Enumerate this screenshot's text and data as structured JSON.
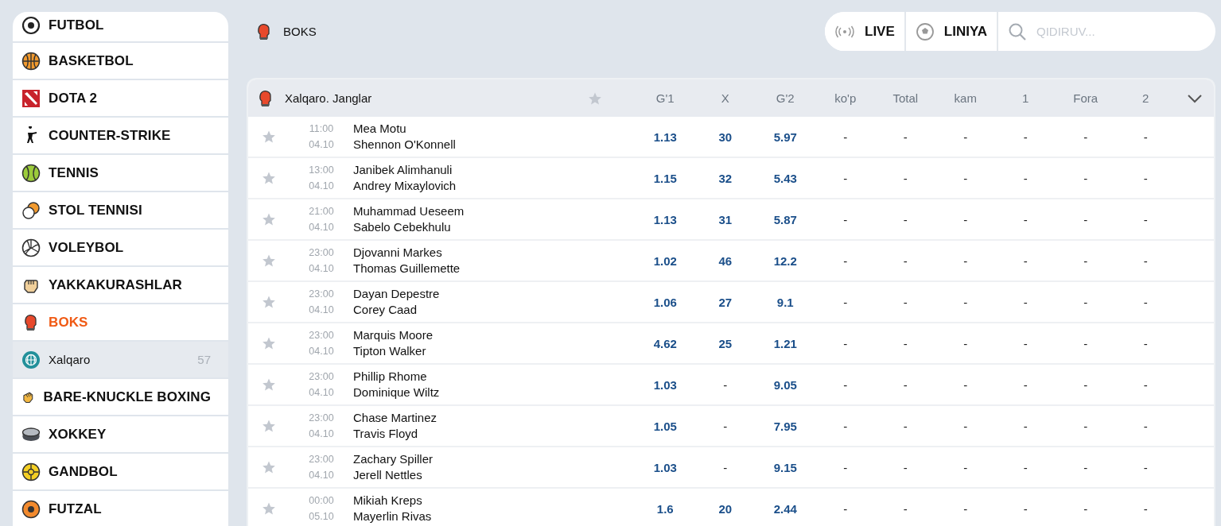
{
  "sidebar": {
    "items": [
      {
        "label": "FUTBOL",
        "kind": "sport",
        "selected": false
      },
      {
        "label": "BASKETBOL",
        "kind": "sport",
        "selected": false
      },
      {
        "label": "DOTA 2",
        "kind": "sport",
        "selected": false
      },
      {
        "label": "COUNTER-STRIKE",
        "kind": "sport",
        "selected": false
      },
      {
        "label": "TENNIS",
        "kind": "sport",
        "selected": false
      },
      {
        "label": "STOL TENNISI",
        "kind": "sport",
        "selected": false
      },
      {
        "label": "VOLEYBOL",
        "kind": "sport",
        "selected": false
      },
      {
        "label": "YAKKAKURASHLAR",
        "kind": "sport",
        "selected": false
      },
      {
        "label": "BOKS",
        "kind": "sport",
        "selected": true
      },
      {
        "label": "Xalqaro",
        "kind": "region",
        "count": "57",
        "selected": true
      },
      {
        "label": "BARE-KNUCKLE BOXING",
        "kind": "sport",
        "selected": false
      },
      {
        "label": "XOKKEY",
        "kind": "sport",
        "selected": false
      },
      {
        "label": "GANDBOL",
        "kind": "sport",
        "selected": false
      },
      {
        "label": "FUTZAL",
        "kind": "sport",
        "selected": false
      }
    ]
  },
  "section_title": "BOKS",
  "nav": [
    {
      "label": "LIVE"
    },
    {
      "label": "LINIYA"
    }
  ],
  "search": {
    "placeholder": "QIDIRUV..."
  },
  "table": {
    "title": "Xalqaro. Janglar",
    "columns": [
      "G'1",
      "X",
      "G'2",
      "ko'p",
      "Total",
      "kam",
      "1",
      "Fora",
      "2"
    ],
    "rows": [
      {
        "time": "11:00",
        "date": "04.10",
        "team1": "Mea Motu",
        "team2": "Shennon O'Konnell",
        "odds": [
          "1.13",
          "30",
          "5.97",
          "-",
          "-",
          "-",
          "-",
          "-",
          "-"
        ]
      },
      {
        "time": "13:00",
        "date": "04.10",
        "team1": "Janibek Alimhanuli",
        "team2": "Andrey Mixaylovich",
        "odds": [
          "1.15",
          "32",
          "5.43",
          "-",
          "-",
          "-",
          "-",
          "-",
          "-"
        ]
      },
      {
        "time": "21:00",
        "date": "04.10",
        "team1": "Muhammad Ueseem",
        "team2": "Sabelo Cebekhulu",
        "odds": [
          "1.13",
          "31",
          "5.87",
          "-",
          "-",
          "-",
          "-",
          "-",
          "-"
        ]
      },
      {
        "time": "23:00",
        "date": "04.10",
        "team1": "Djovanni Markes",
        "team2": "Thomas Guillemette",
        "odds": [
          "1.02",
          "46",
          "12.2",
          "-",
          "-",
          "-",
          "-",
          "-",
          "-"
        ]
      },
      {
        "time": "23:00",
        "date": "04.10",
        "team1": "Dayan Depestre",
        "team2": "Corey Caad",
        "odds": [
          "1.06",
          "27",
          "9.1",
          "-",
          "-",
          "-",
          "-",
          "-",
          "-"
        ]
      },
      {
        "time": "23:00",
        "date": "04.10",
        "team1": "Marquis Moore",
        "team2": "Tipton Walker",
        "odds": [
          "4.62",
          "25",
          "1.21",
          "-",
          "-",
          "-",
          "-",
          "-",
          "-"
        ]
      },
      {
        "time": "23:00",
        "date": "04.10",
        "team1": "Phillip Rhome",
        "team2": "Dominique Wiltz",
        "odds": [
          "1.03",
          "-",
          "9.05",
          "-",
          "-",
          "-",
          "-",
          "-",
          "-"
        ]
      },
      {
        "time": "23:00",
        "date": "04.10",
        "team1": "Chase Martinez",
        "team2": "Travis Floyd",
        "odds": [
          "1.05",
          "-",
          "7.95",
          "-",
          "-",
          "-",
          "-",
          "-",
          "-"
        ]
      },
      {
        "time": "23:00",
        "date": "04.10",
        "team1": "Zachary Spiller",
        "team2": "Jerell Nettles",
        "odds": [
          "1.03",
          "-",
          "9.15",
          "-",
          "-",
          "-",
          "-",
          "-",
          "-"
        ]
      },
      {
        "time": "00:00",
        "date": "05.10",
        "team1": "Mikiah Kreps",
        "team2": "Mayerlin Rivas",
        "odds": [
          "1.6",
          "20",
          "2.44",
          "-",
          "-",
          "-",
          "-",
          "-",
          "-"
        ]
      }
    ]
  }
}
